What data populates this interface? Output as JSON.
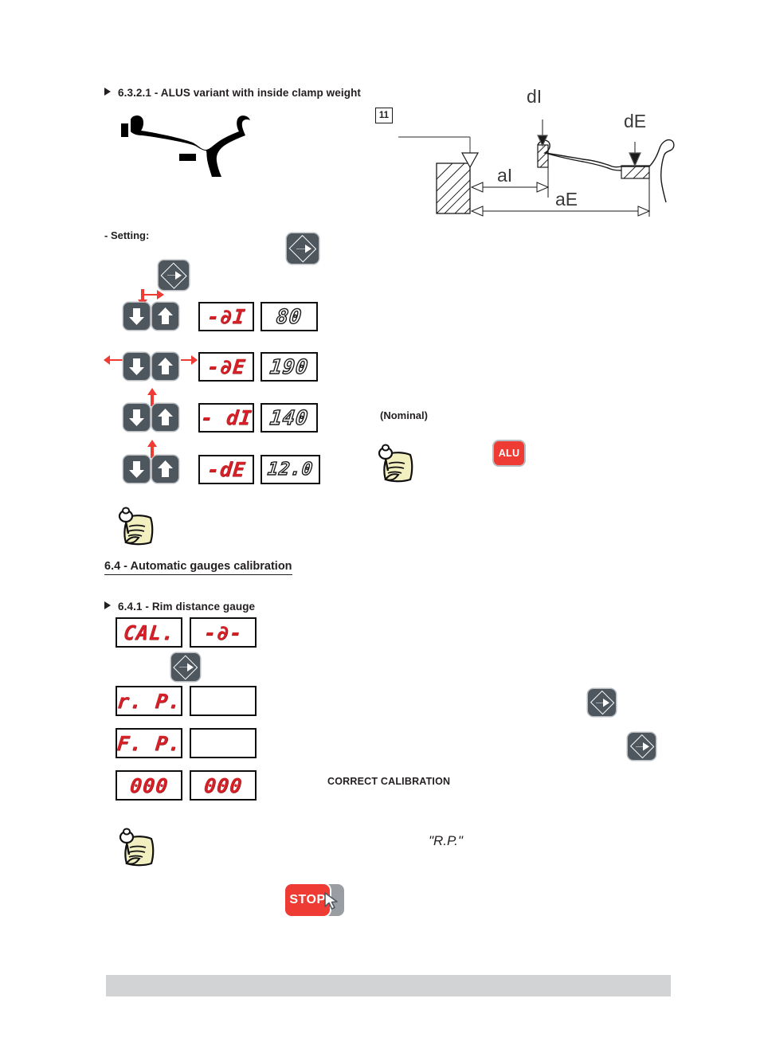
{
  "section_a": {
    "heading": "6.3.2.1 - ALUS variant with inside clamp weight",
    "setting_label": "- Setting:",
    "nominal_label": "(Nominal)",
    "alu_badge": "ALU",
    "rows": [
      {
        "name_display": "-∂I",
        "value_display": "80"
      },
      {
        "name_display": "-∂E",
        "value_display": "190"
      },
      {
        "name_display": "- dI",
        "value_display": "140"
      },
      {
        "name_display": "-dE",
        "value_display": "12.0"
      }
    ]
  },
  "diagram": {
    "number": "11",
    "labels": {
      "dI": "dI",
      "dE": "dE",
      "aI": "aI",
      "aE": "aE"
    }
  },
  "section_b": {
    "heading": "6.4 - Automatic gauges calibration",
    "subheading": "6.4.1 - Rim distance gauge",
    "correct_label": "CORRECT CALIBRATION",
    "rp_quote": "\"R.P.\"",
    "rows": [
      {
        "left_display": "CAL.",
        "right_display": "-∂-"
      },
      {
        "left_display": "r. P.",
        "right_display": ""
      },
      {
        "left_display": "F. P.",
        "right_display": ""
      },
      {
        "left_display": "000",
        "right_display": "000"
      }
    ],
    "stop_label": "STOP"
  },
  "colors": {
    "segment_red": "#d62027",
    "button_body": "#4e565e",
    "accent_red": "#ee3b33",
    "footer_gray": "#d1d3d4",
    "note_paper": "#f2efc0"
  }
}
